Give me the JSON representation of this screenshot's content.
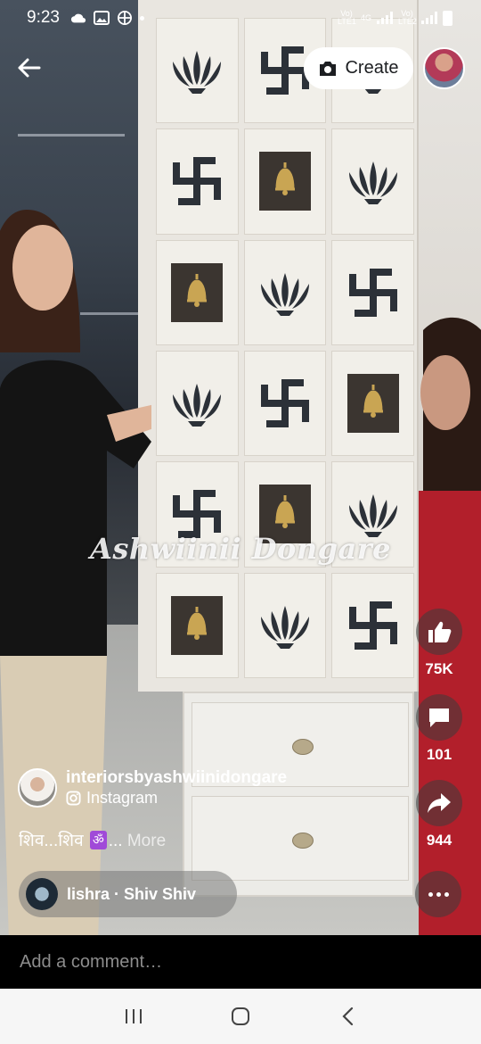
{
  "status_bar": {
    "time": "9:23",
    "sim1_label": "Vo) LTE1",
    "net_label": "4G",
    "sim2_label": "Vo) LTE2"
  },
  "top": {
    "create_label": "Create",
    "icons": {
      "back": "back-arrow-icon",
      "camera": "camera-icon"
    }
  },
  "video": {
    "watermark": "Ashwiinii Dongare"
  },
  "actions": {
    "like_count": "75K",
    "comment_count": "101",
    "share_count": "944"
  },
  "author": {
    "name": "interiorsbyashwiinidongare",
    "source": "Instagram"
  },
  "caption": {
    "text_start": "शिव...शिव",
    "emoji": "ॐ",
    "text_end": "...",
    "more_label": "More"
  },
  "audio": {
    "label": "lishra · Shiv Shiv"
  },
  "comment_bar": {
    "placeholder": "Add a comment…"
  },
  "colors": {
    "accent_white": "#ffffff",
    "om_badge": "#a04ad8",
    "nav_background": "#f6f6f6"
  }
}
